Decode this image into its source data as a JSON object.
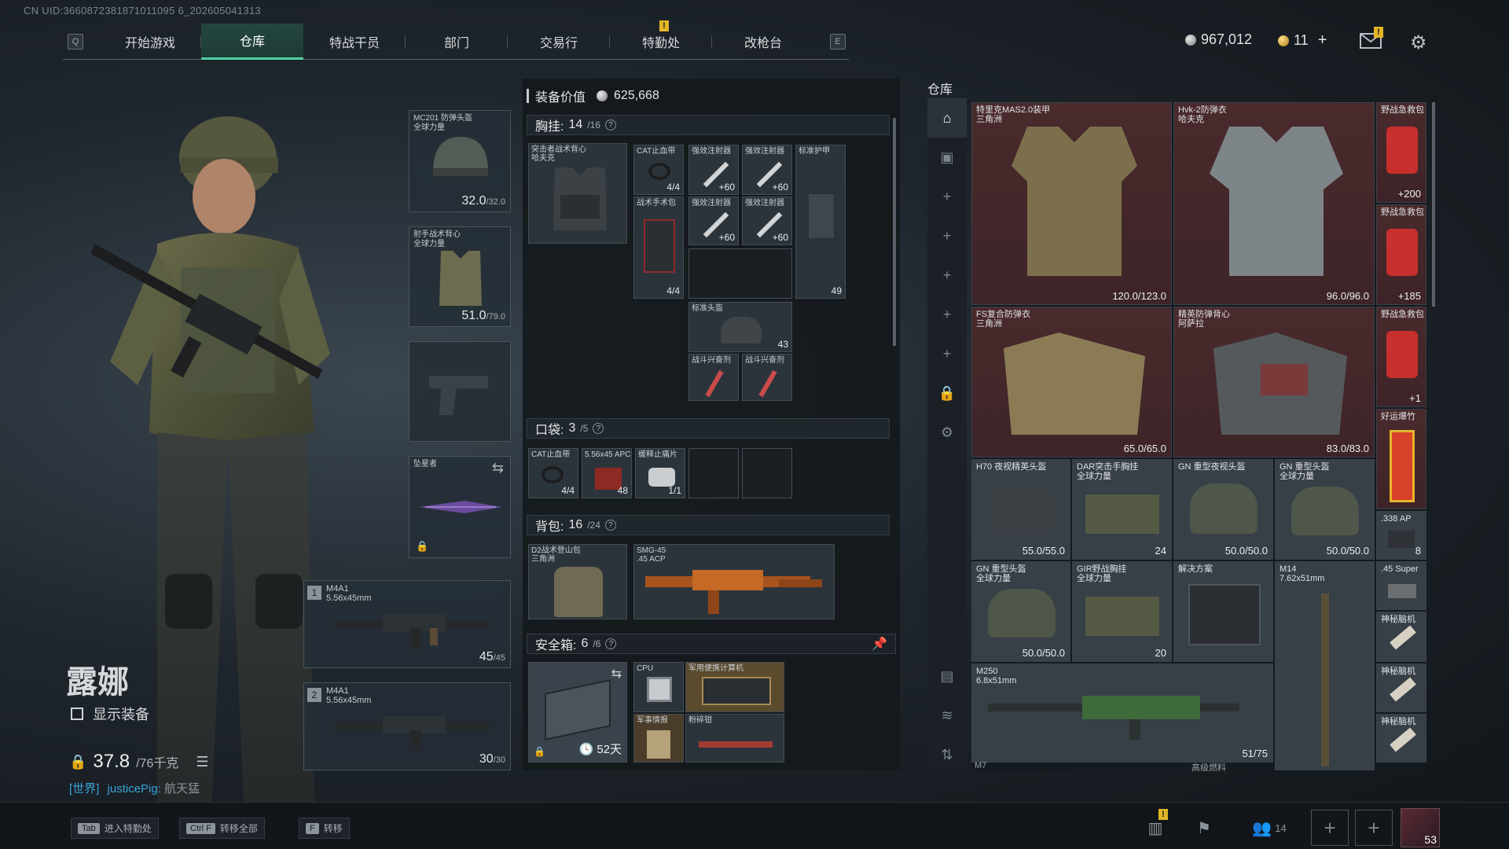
{
  "uid": "CN UID:3660872381871011095 6_202605041313",
  "nav": {
    "key_left": "Q",
    "key_right": "E",
    "tabs": [
      {
        "label": "开始游戏"
      },
      {
        "label": "仓库",
        "active": true
      },
      {
        "label": "特战干员"
      },
      {
        "label": "部门"
      },
      {
        "label": "交易行"
      },
      {
        "label": "特勤处"
      },
      {
        "label": "改枪台"
      }
    ],
    "alert": "!"
  },
  "currency": {
    "silver": "967,012",
    "gold": "11",
    "gold_plus": "+"
  },
  "character": {
    "name": "露娜",
    "show_equipment": "显示装备",
    "weight_value": "37.8",
    "weight_limit": "/76千克"
  },
  "chat": {
    "channel": "[世界]",
    "user": "justicePig:",
    "message": "航天猛"
  },
  "loadout": {
    "helmet": {
      "name": "MC201 防弹头盔",
      "sub": "全球力量",
      "value": "32.0",
      "max": "/32.0"
    },
    "armor": {
      "name": "射手战术背心",
      "sub": "全球力量",
      "value": "51.0",
      "max": "/79.0"
    },
    "melee": {
      "name": "坠星者"
    },
    "primary1": {
      "index": "1",
      "name": "M4A1",
      "caliber": "5.56x45mm",
      "ammo": "45",
      "ammo_max": "/45"
    },
    "primary2": {
      "index": "2",
      "name": "M4A1",
      "caliber": "5.56x45mm",
      "ammo": "30",
      "ammo_max": "/30"
    }
  },
  "equipment_value": {
    "label": "装备价值",
    "value": "625,668"
  },
  "chest_rig": {
    "label": "胸挂:",
    "used": "14",
    "cap": "/16",
    "rig_name": "突击者战术背心",
    "rig_sub": "哈夫克",
    "items": [
      {
        "name": "CAT止血带",
        "count": "4/4"
      },
      {
        "name": "强效注射器",
        "count": "+60"
      },
      {
        "name": "强效注射器",
        "count": "+60"
      },
      {
        "name": "标准护甲",
        "count": "49"
      },
      {
        "name": "战术手术包",
        "count": "4/4"
      },
      {
        "name": "强效注射器",
        "count": "+60"
      },
      {
        "name": "强效注射器",
        "count": "+60"
      },
      {
        "name": "标准头盔",
        "count": "43"
      },
      {
        "name": "战斗兴奋剂",
        "count": ""
      },
      {
        "name": "战斗兴奋剂",
        "count": ""
      }
    ]
  },
  "pocket": {
    "label": "口袋:",
    "used": "3",
    "cap": "/5",
    "items": [
      {
        "name": "CAT止血带",
        "count": "4/4"
      },
      {
        "name": "5.56x45 APC",
        "count": "48"
      },
      {
        "name": "缓释止痛片",
        "count": "1/1"
      }
    ]
  },
  "backpack": {
    "label": "背包:",
    "used": "16",
    "cap": "/24",
    "items": [
      {
        "name": "D2战术登山包",
        "sub": "三角洲"
      },
      {
        "name": "SMG-45",
        "sub": ".45 ACP"
      }
    ]
  },
  "safebox": {
    "label": "安全箱:",
    "used": "6",
    "cap": "/6",
    "days": "52天",
    "items": [
      {
        "name": "CPU"
      },
      {
        "name": "军用便携计算机"
      },
      {
        "name": "军事情报"
      },
      {
        "name": "粉碎钳"
      }
    ]
  },
  "warehouse": {
    "title": "仓库",
    "items": [
      {
        "name": "特里克MAS2.0装甲",
        "sub": "三角洲",
        "count": "120.0/123.0"
      },
      {
        "name": "Hvk-2防弹衣",
        "sub": "哈夫克",
        "count": "96.0/96.0"
      },
      {
        "name": "野战急救包",
        "count": "+200"
      },
      {
        "name": "野战急救包",
        "count": "+185"
      },
      {
        "name": "FS复合防弹衣",
        "sub": "三角洲",
        "count": "65.0/65.0"
      },
      {
        "name": "精英防弹背心",
        "sub": "阿萨拉",
        "count": "83.0/83.0"
      },
      {
        "name": "野战急救包",
        "count": "+1"
      },
      {
        "name": "好运爆竹",
        "count": ""
      },
      {
        "name": "H70 夜视精英头盔",
        "count": "55.0/55.0"
      },
      {
        "name": "DAR突击手胸挂",
        "sub": "全球力量",
        "count": "24"
      },
      {
        "name": "GN 重型夜视头盔",
        "count": "50.0/50.0"
      },
      {
        "name": "GN 重型头盔",
        "sub": "全球力量",
        "count": "50.0/50.0"
      },
      {
        "name": ".338 AP",
        "count": "8"
      },
      {
        "name": "GN 重型头盔",
        "sub": "全球力量",
        "count": "50.0/50.0"
      },
      {
        "name": "GIR野战胸挂",
        "sub": "全球力量",
        "count": "20"
      },
      {
        "name": "解决方案",
        "count": ""
      },
      {
        "name": "M14",
        "sub": "7.62x51mm",
        "count": ""
      },
      {
        "name": ".45 Super",
        "count": ""
      },
      {
        "name": "神秘脑机",
        "count": ""
      },
      {
        "name": "M250",
        "sub": "6.8x51mm",
        "count": "51/75"
      },
      {
        "name": "神秘脑机",
        "count": ""
      },
      {
        "name": "神秘脑机",
        "count": ""
      },
      {
        "name": "M7",
        "count": ""
      },
      {
        "name": "高级燃料",
        "count": ""
      }
    ]
  },
  "bottom": {
    "hotkeys": [
      {
        "key": "Tab",
        "label": "进入特勤处"
      },
      {
        "key": "Ctrl F",
        "label": "转移全部"
      },
      {
        "key": "F",
        "label": "转移"
      }
    ],
    "squad_count": "14",
    "level": "53"
  },
  "colors": {
    "accent": "#4fd0a6",
    "warning": "#e2b526",
    "rare_bg": "#4a2a2c"
  }
}
